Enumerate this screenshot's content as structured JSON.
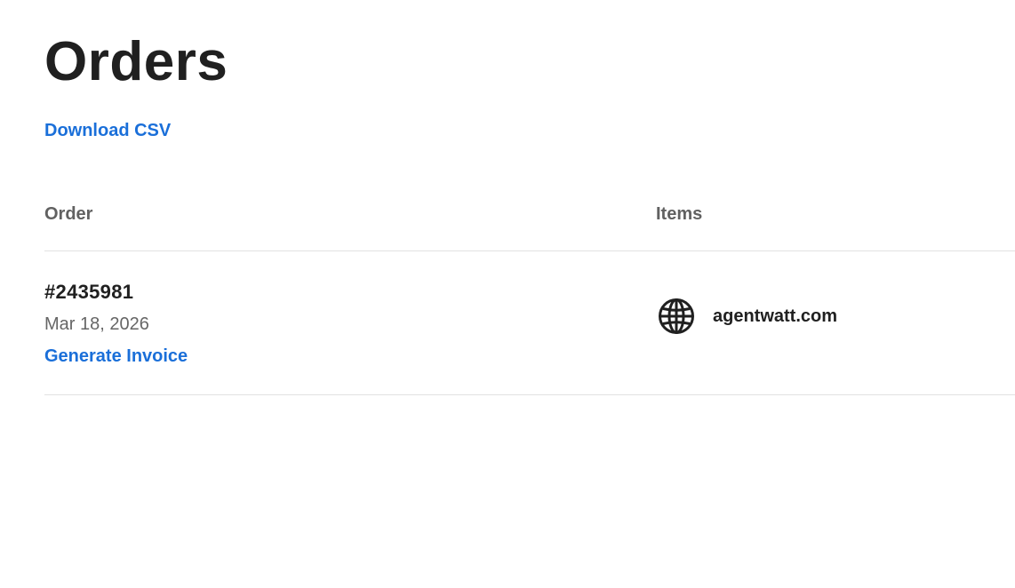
{
  "page": {
    "title": "Orders",
    "download_label": "Download CSV"
  },
  "table": {
    "columns": [
      "Order",
      "Items"
    ],
    "rows": [
      {
        "order_number": "#2435981",
        "date": "Mar 18, 2026",
        "action_label": "Generate Invoice",
        "items": [
          {
            "icon": "globe-icon",
            "name": "agentwatt.com"
          }
        ]
      }
    ]
  },
  "colors": {
    "link": "#1a6fd9",
    "text": "#202020",
    "muted": "#666666",
    "divider": "#e2e2e2"
  }
}
